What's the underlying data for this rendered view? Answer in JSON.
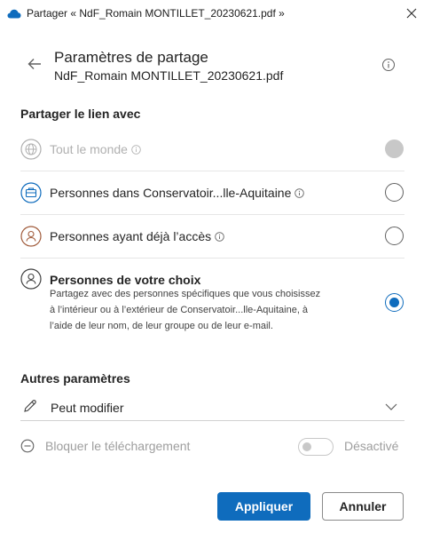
{
  "window": {
    "title": "Partager « NdF_Romain MONTILLET_20230621.pdf »",
    "cloud_icon": "onedrive-cloud-icon",
    "close_icon": "close-icon"
  },
  "header": {
    "title": "Paramètres de partage",
    "subtitle": "NdF_Romain MONTILLET_20230621.pdf",
    "back_icon": "back-arrow-icon",
    "info_icon": "info-icon"
  },
  "share_with": {
    "heading": "Partager le lien avec",
    "options": [
      {
        "label": "Tout le monde",
        "icon": "globe-icon",
        "has_info": true,
        "state": "disabled"
      },
      {
        "label": "Personnes dans Conservatoir...lle-Aquitaine",
        "icon": "organization-icon",
        "has_info": true,
        "state": "unselected"
      },
      {
        "label": "Personnes ayant déjà l’accès",
        "icon": "person-access-icon",
        "has_info": true,
        "state": "unselected"
      },
      {
        "label": "Personnes de votre choix",
        "icon": "person-icon",
        "has_info": false,
        "state": "selected",
        "description_lines": [
          "Partagez avec des personnes spécifiques que vous choisissez",
          "à l’intérieur ou à l’extérieur de Conservatoir...lle-Aquitaine, à",
          "l’aide de leur nom, de leur groupe ou de leur e-mail."
        ]
      }
    ]
  },
  "other_settings": {
    "heading": "Autres paramètres",
    "permission": {
      "label": "Peut modifier",
      "icon": "pencil-icon",
      "chevron": "chevron-down-icon"
    },
    "block_download": {
      "label": "Bloquer le téléchargement",
      "icon": "block-icon",
      "toggle_state": "Désactivé",
      "toggle_on": false
    }
  },
  "colors": {
    "accent": "#0f6cbd",
    "disabled": "#b0b0b0"
  },
  "footer": {
    "apply_label": "Appliquer",
    "cancel_label": "Annuler"
  }
}
